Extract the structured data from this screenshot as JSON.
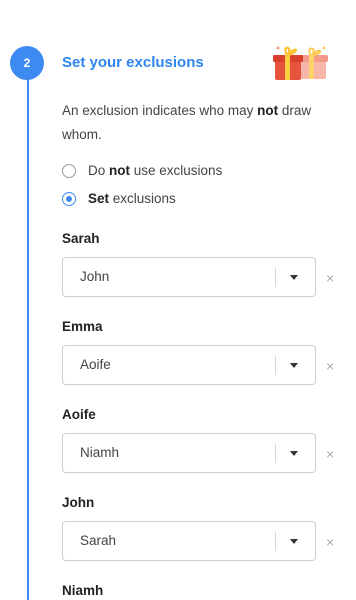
{
  "step": {
    "number": "2",
    "title": "Set your exclusions",
    "icon": "gift-icon"
  },
  "description": {
    "part1": "An exclusion indicates who may ",
    "bold": "not",
    "part2": " draw whom."
  },
  "radio_options": [
    {
      "prefix": "Do ",
      "bold": "not",
      "suffix": " use exclusions",
      "checked": false
    },
    {
      "prefix": "",
      "bold": "Set",
      "suffix": " exclusions",
      "checked": true
    }
  ],
  "exclusions": [
    {
      "person": "Sarah",
      "excluded": "John"
    },
    {
      "person": "Emma",
      "excluded": "Aoife"
    },
    {
      "person": "Aoife",
      "excluded": "Niamh"
    },
    {
      "person": "John",
      "excluded": "Sarah"
    },
    {
      "person": "Niamh",
      "excluded": ""
    }
  ],
  "remove_symbol": "×",
  "colors": {
    "accent": "#3d8bf2",
    "title": "#2f86f0"
  }
}
